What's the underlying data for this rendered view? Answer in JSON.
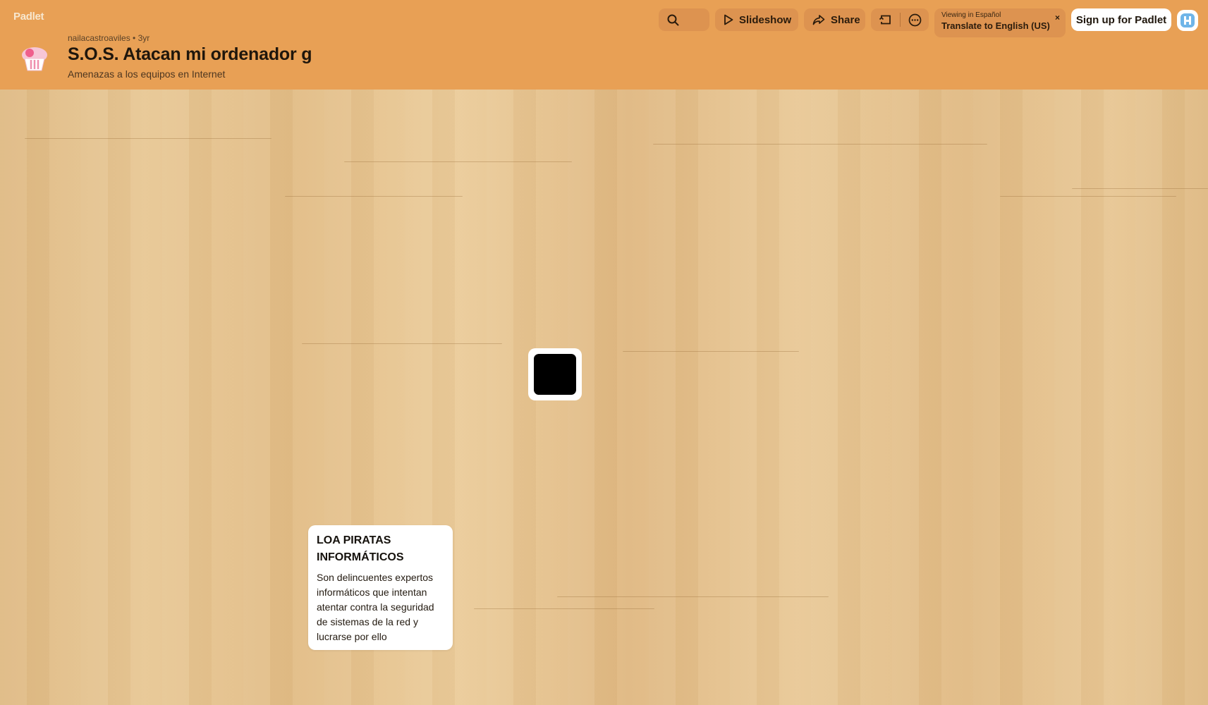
{
  "app": {
    "logo": "Padlet"
  },
  "header": {
    "author": "nailacastroaviles • 3yr",
    "title": "S.O.S. Atacan mi ordenador g",
    "subtitle": "Amenazas a los equipos en Internet"
  },
  "toolbar": {
    "search_icon": "search-icon",
    "slideshow_label": "Slideshow",
    "share_label": "Share",
    "remake_icon": "remake-icon",
    "more_icon": "more-icon",
    "translate": {
      "viewing": "Viewing in Español",
      "action": "Translate to English (US)",
      "close": "×"
    },
    "signup_label": "Sign up for Padlet"
  },
  "board": {
    "posts": [
      {
        "title": "LOA PIRATAS INFORMÁTICOS",
        "body": "Son delincuentes expertos informáticos que intentan atentar contra la seguridad de sistemas de la red y lucrarse por ello"
      }
    ]
  },
  "colors": {
    "header_bg": "#e8a055",
    "button_bg": "#dd9350",
    "board_bg": "#e5c48e",
    "card_bg": "#ffffff"
  }
}
